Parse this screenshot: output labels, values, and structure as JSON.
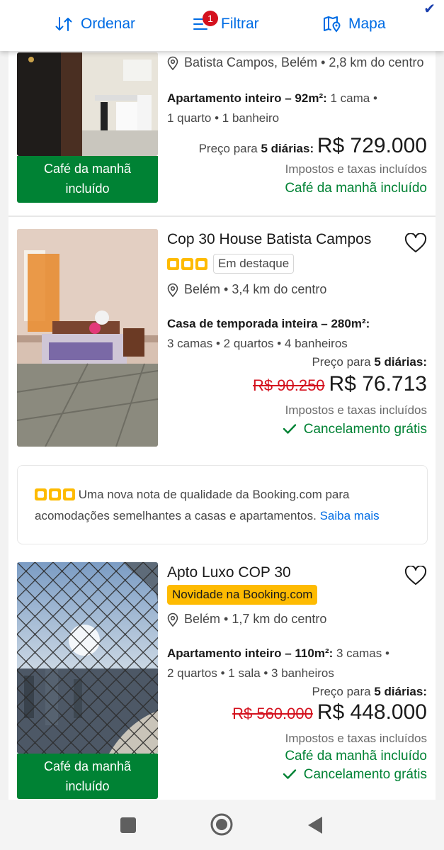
{
  "topbar": {
    "sort_label": "Ordenar",
    "filter_label": "Filtrar",
    "filter_count": "1",
    "map_label": "Mapa",
    "corner_mark": "✔"
  },
  "listings": [
    {
      "location": "Batista Campos, Belém • 2,8 km do centro",
      "desc_bold": "Apartamento inteiro – 92m²:",
      "desc_line1": " 1 cama •",
      "desc_line2": "1 quarto • 1 banheiro",
      "price_prefix": "Preço para ",
      "price_nights": "5 diárias:",
      "price": "R$ 729.000",
      "taxes": "Impostos e taxas incluídos",
      "perk": "Café da manhã incluído",
      "ribbon_line1": "Café da manhã",
      "ribbon_line2": "incluído"
    },
    {
      "name": "Cop 30 House Batista Campos",
      "badge": "Em destaque",
      "location": "Belém • 3,4 km do centro",
      "desc_bold": "Casa de temporada inteira – 280m²:",
      "desc_line2": "3 camas • 2 quartos • 4 banheiros",
      "price_prefix": "Preço para ",
      "price_nights": "5 diárias:",
      "old_price": "R$ 90.250",
      "price": "R$ 76.713",
      "taxes": "Impostos e taxas incluídos",
      "perk": "Cancelamento grátis"
    },
    {
      "name": "Apto Luxo COP 30",
      "badge": "Novidade na Booking.com",
      "location": "Belém • 1,7 km do centro",
      "desc_bold": "Apartamento inteiro – 110m²:",
      "desc_line1": " 3 camas •",
      "desc_line2": "2 quartos • 1 sala • 3 banheiros",
      "price_prefix": "Preço para ",
      "price_nights": "5 diárias:",
      "old_price": "R$ 560.000",
      "price": "R$ 448.000",
      "taxes": "Impostos e taxas incluídos",
      "perk1": "Café da manhã incluído",
      "perk2": "Cancelamento grátis",
      "ribbon_line1": "Café da manhã",
      "ribbon_line2": "incluído"
    }
  ],
  "notice": {
    "text": "Uma nova nota de qualidade da Booking.com para acomodações semelhantes a casas e apartamentos.",
    "link": "Saiba mais"
  },
  "colors": {
    "brand_blue": "#006ce4",
    "green": "#008234",
    "red": "#d4111e",
    "yellow": "#febb02"
  },
  "icons": {
    "sort": "sort-arrows-icon",
    "filter": "filter-sliders-icon",
    "map": "map-pin-icon",
    "location": "location-pin-icon",
    "favorite": "heart-icon",
    "check": "check-icon",
    "nav_recents": "square-icon",
    "nav_home": "circle-icon",
    "nav_back": "triangle-back-icon"
  }
}
